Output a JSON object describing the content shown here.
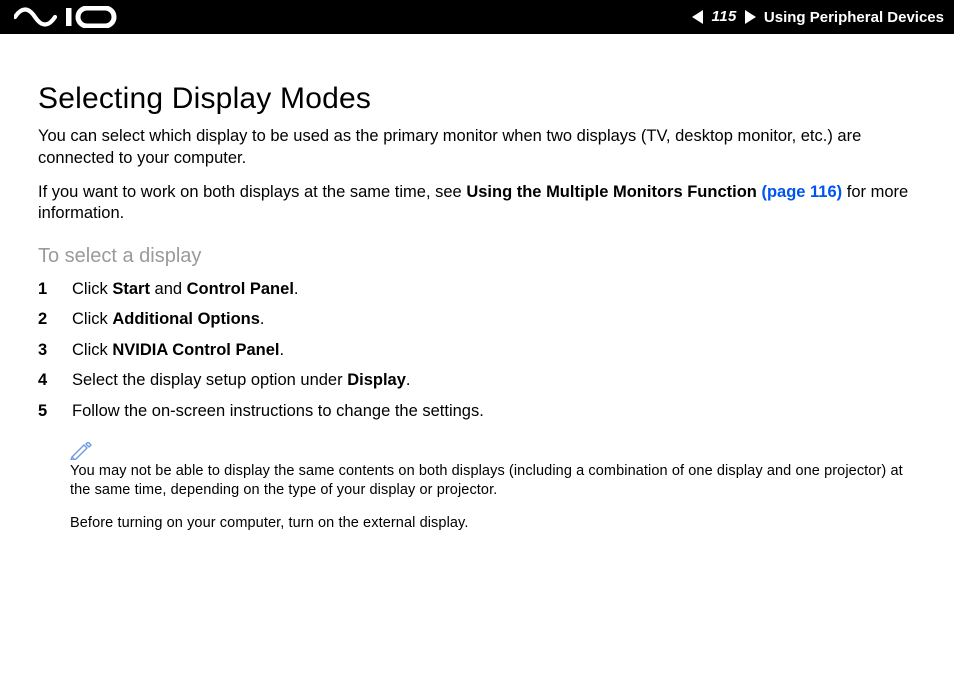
{
  "header": {
    "page_number": "115",
    "section_title": "Using Peripheral Devices"
  },
  "content": {
    "title": "Selecting Display Modes",
    "intro_1": "You can select which display to be used as the primary monitor when two displays (TV, desktop monitor, etc.) are connected to your computer.",
    "intro_2a": "If you want to work on both displays at the same time, see ",
    "intro_2_bold": "Using the Multiple Monitors Function ",
    "intro_2_link": "(page 116)",
    "intro_2b": " for more information.",
    "subhead": "To select a display",
    "steps": {
      "s1a": "Click ",
      "s1b": "Start",
      "s1c": " and ",
      "s1d": "Control Panel",
      "s1e": ".",
      "s2a": "Click ",
      "s2b": "Additional Options",
      "s2c": ".",
      "s3a": "Click ",
      "s3b": "NVIDIA Control Panel",
      "s3c": ".",
      "s4a": "Select the display setup option under ",
      "s4b": "Display",
      "s4c": ".",
      "s5": "Follow the on-screen instructions to change the settings."
    },
    "note_1": "You may not be able to display the same contents on both displays (including a combination of one display and one projector) at the same time, depending on the type of your display or projector.",
    "note_2": "Before turning on your computer, turn on the external display."
  }
}
